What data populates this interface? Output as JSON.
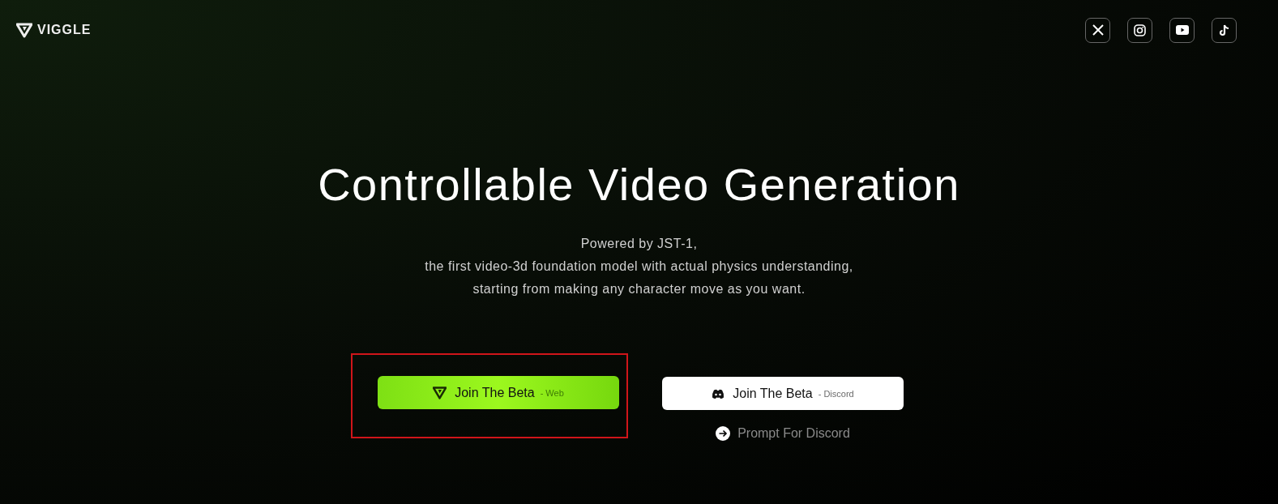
{
  "header": {
    "logo": "VIGGLE",
    "social": [
      {
        "kind": "x"
      },
      {
        "kind": "instagram"
      },
      {
        "kind": "youtube"
      },
      {
        "kind": "tiktok"
      }
    ]
  },
  "hero": {
    "title": "Controllable Video Generation",
    "subtitle": [
      "Powered by JST-1,",
      "the first video-3d foundation model with actual physics understanding,",
      "starting from making any character move as you want."
    ]
  },
  "actions": [
    {
      "kind": "web",
      "label": "Join The Beta",
      "note": "- Web",
      "highlighted": true
    },
    {
      "kind": "discord",
      "label": "Join The Beta",
      "note": "- Discord",
      "highlighted": false
    }
  ],
  "prompt_link": "Prompt For Discord"
}
